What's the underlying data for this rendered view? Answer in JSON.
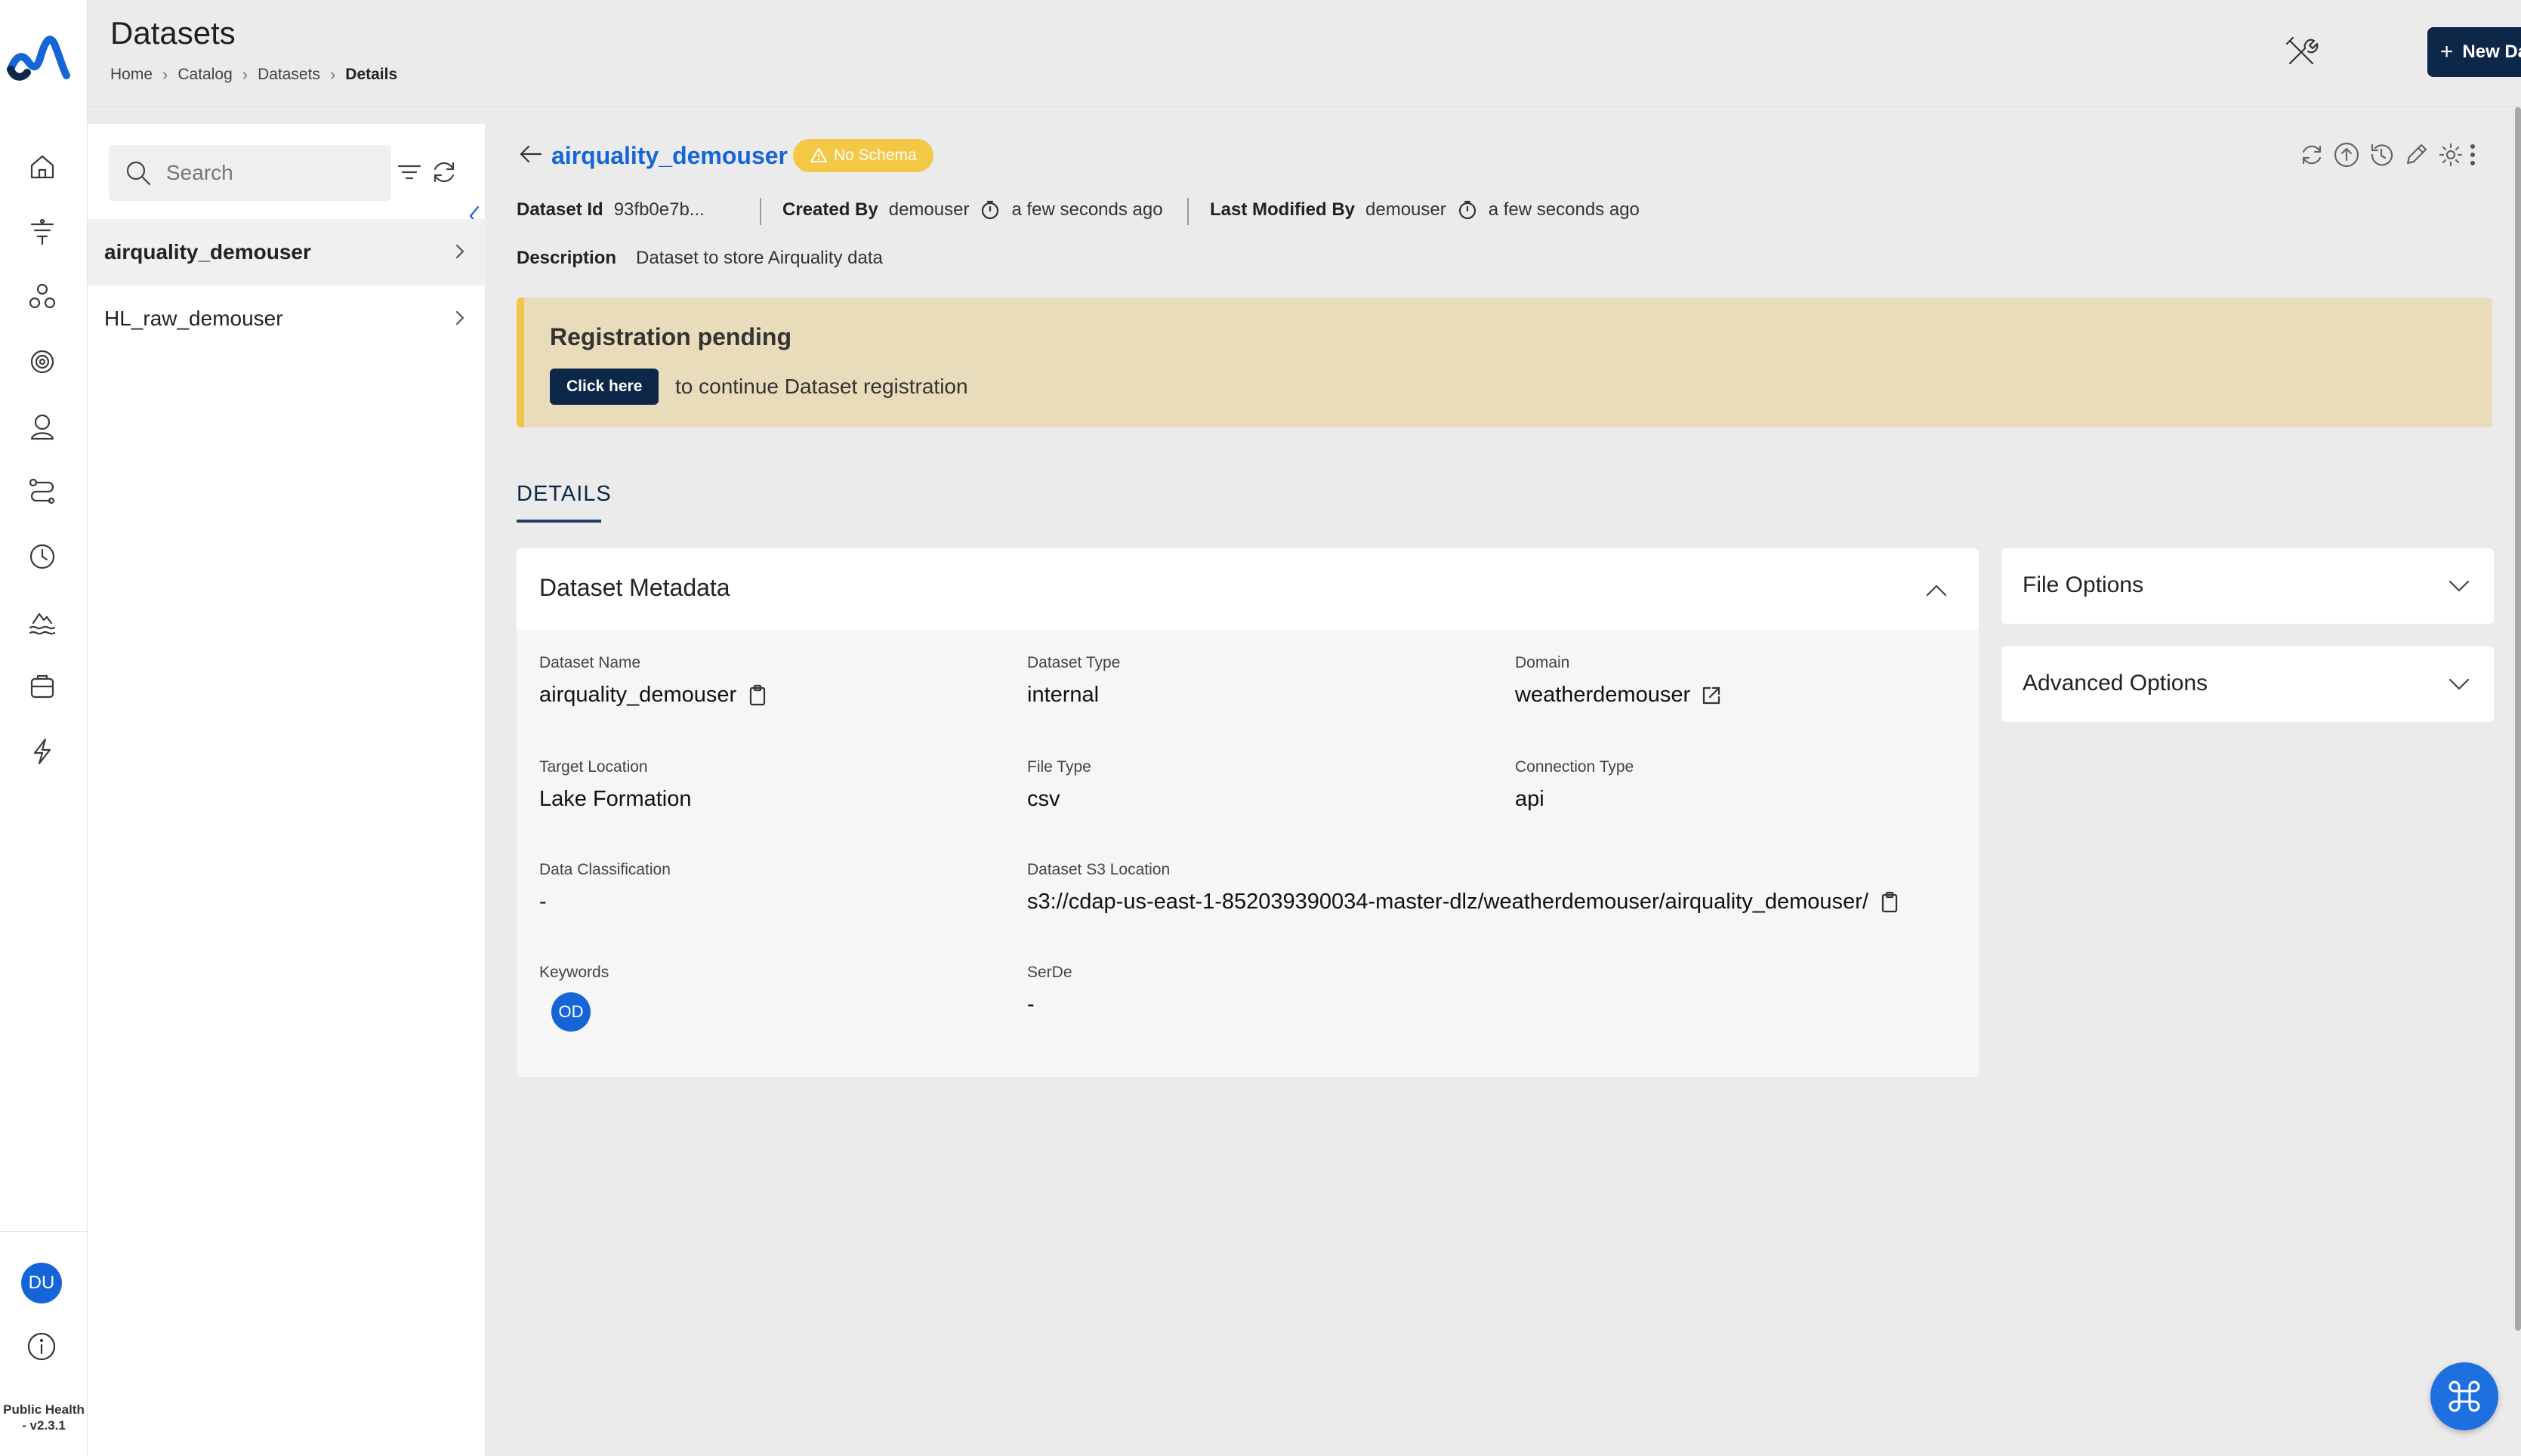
{
  "header": {
    "title": "Datasets",
    "breadcrumb": [
      "Home",
      "Catalog",
      "Datasets",
      "Details"
    ],
    "new_button": "New Dataset"
  },
  "rail": {
    "items": [
      "home-icon",
      "pipeline-icon",
      "nodes-icon",
      "target-icon",
      "profile-icon",
      "workflow-icon",
      "schedule-icon",
      "lake-icon",
      "storage-icon",
      "lightning-icon"
    ],
    "user_initials": "DU",
    "version": "Public Health - v2.3.1"
  },
  "list": {
    "search_placeholder": "Search",
    "items": [
      {
        "label": "airquality_demouser",
        "active": true
      },
      {
        "label": "HL_raw_demouser",
        "active": false
      }
    ]
  },
  "dataset": {
    "name": "airquality_demouser",
    "badge": "No Schema",
    "id_label": "Dataset Id",
    "id_value": "93fb0e7b...",
    "created_by_label": "Created By",
    "created_by": "demouser",
    "created_time": "a few seconds ago",
    "modified_by_label": "Last Modified By",
    "modified_by": "demouser",
    "modified_time": "a few seconds ago",
    "description_label": "Description",
    "description": "Dataset to store Airquality data"
  },
  "banner": {
    "title": "Registration pending",
    "button": "Click here",
    "text": "to continue Dataset registration"
  },
  "tabs": {
    "details": "DETAILS"
  },
  "metadata": {
    "title": "Dataset Metadata",
    "dataset_name_label": "Dataset Name",
    "dataset_name": "airquality_demouser",
    "dataset_type_label": "Dataset Type",
    "dataset_type": "internal",
    "domain_label": "Domain",
    "domain": "weatherdemouser",
    "target_location_label": "Target Location",
    "target_location": "Lake Formation",
    "file_type_label": "File Type",
    "file_type": "csv",
    "connection_type_label": "Connection Type",
    "connection_type": "api",
    "classification_label": "Data Classification",
    "classification": "-",
    "s3_label": "Dataset S3 Location",
    "s3": "s3://cdap-us-east-1-852039390034-master-dlz/weatherdemouser/airquality_demouser/",
    "keywords_label": "Keywords",
    "keyword_initials": "OD",
    "serde_label": "SerDe",
    "serde": "-"
  },
  "side": {
    "file_options": "File Options",
    "advanced_options": "Advanced Options"
  },
  "colors": {
    "accent": "#1565d8",
    "navy": "#0d2748",
    "warning": "#f3c845",
    "banner_bg": "#e8dcbb"
  }
}
